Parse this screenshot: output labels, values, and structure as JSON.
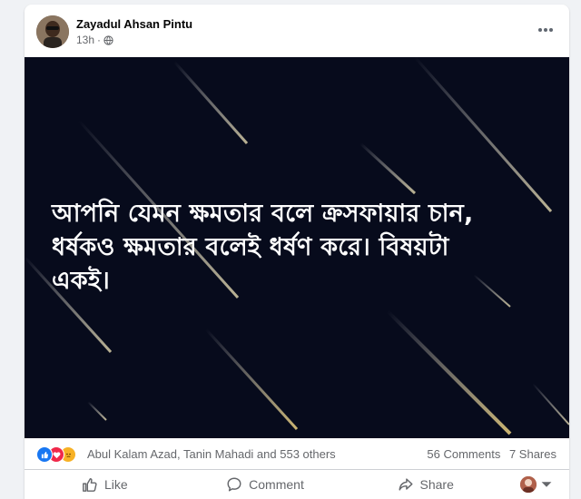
{
  "post": {
    "author": "Zayadul Ahsan Pintu",
    "time": "13h",
    "privacy_icon": "globe-icon",
    "image_text": {
      "lines": [
        "আপনি যেমন ক্ষমতার বলে ক্রসফায়ার চান,",
        "ধর্ষকও ক্ষমতার বলেই ধর্ষণ করে। বিষয়টা",
        "একই।"
      ]
    },
    "reactions": {
      "icons": [
        "like-icon",
        "love-icon",
        "sad-icon"
      ],
      "summary": "Abul Kalam Azad, Tanin Mahadi and 553 others"
    },
    "counts": {
      "comments": "56 Comments",
      "shares": "7 Shares"
    },
    "actions": {
      "like": "Like",
      "comment": "Comment",
      "share": "Share"
    }
  },
  "colors": {
    "image_background": "#070b1c",
    "action_gray": "#65676b",
    "like_blue": "#1877f2"
  }
}
